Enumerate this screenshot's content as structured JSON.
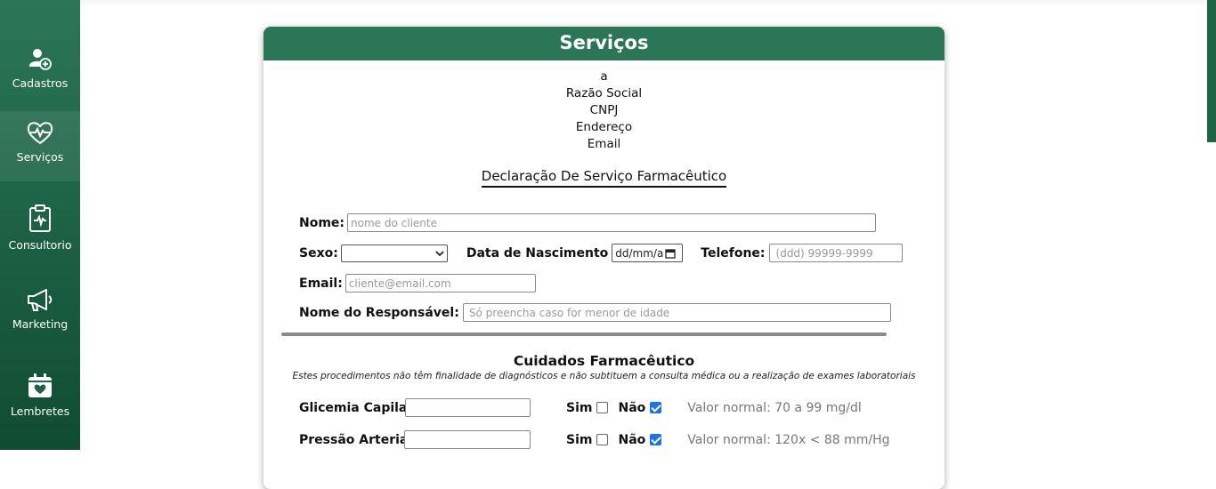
{
  "sidebar": {
    "items": [
      {
        "label": "Cadastros",
        "icon": "user-add-icon"
      },
      {
        "label": "Serviços",
        "icon": "heart-pulse-icon"
      },
      {
        "label": "Consultorio",
        "icon": "clipboard-pulse-icon"
      },
      {
        "label": "Marketing",
        "icon": "megaphone-icon"
      },
      {
        "label": "Lembretes",
        "icon": "calendar-heart-icon"
      }
    ],
    "active": "Serviços"
  },
  "card": {
    "title": "Serviços",
    "company": {
      "name": "a",
      "razao_social": "Razão Social",
      "cnpj": "CNPJ",
      "endereco": "Endereço",
      "email": "Email"
    },
    "declaration_title": "Declaração De Serviço Farmacêutico"
  },
  "form": {
    "nome_label": "Nome:",
    "nome_placeholder": "nome do cliente",
    "sexo_label": "Sexo:",
    "sexo_value": "",
    "nascimento_label": "Data de Nascimento",
    "nascimento_value": "dd/mm/a",
    "telefone_label": "Telefone:",
    "telefone_placeholder": "(ddd) 99999-9999",
    "email_label": "Email:",
    "email_placeholder": "cliente@email.com",
    "responsavel_label": "Nome do Responsável:",
    "responsavel_placeholder": "Só preencha caso for menor de idade"
  },
  "cuidados": {
    "title": "Cuidados Farmacêutico",
    "note": "Estes procedimentos não têm finalidade de diagnósticos e não subtituem a consulta médica ou a realização de exames laboratoriais",
    "sim_label": "Sim",
    "nao_label": "Não",
    "rows": [
      {
        "label": "Glicemia Capilar:",
        "value": "",
        "sim": false,
        "nao": true,
        "normal": "Valor normal: 70 a 99 mg/dl"
      },
      {
        "label": "Pressão Arterial:",
        "value": "",
        "sim": false,
        "nao": true,
        "normal": "Valor normal: 120x < 88 mm/Hg"
      }
    ]
  },
  "colors": {
    "brand_green": "#2b7657",
    "sidebar_dark": "#104c32",
    "checkbox_blue": "#1a73e8"
  }
}
